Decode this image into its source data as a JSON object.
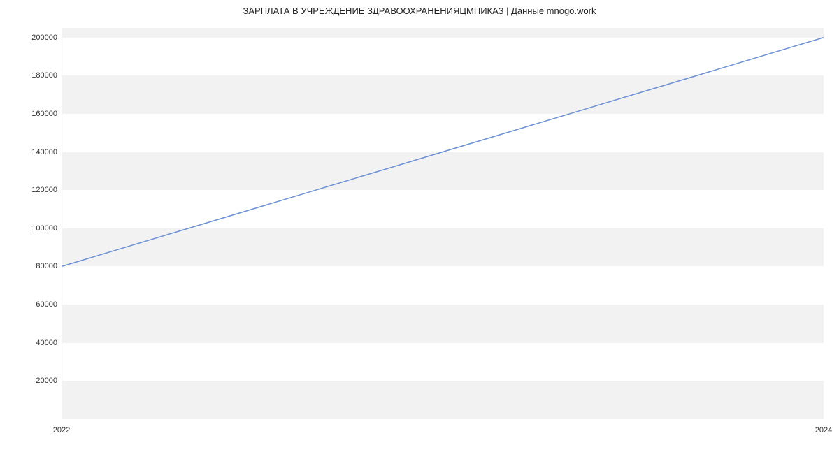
{
  "chart_data": {
    "type": "line",
    "title": "ЗАРПЛАТА В УЧРЕЖДЕНИЕ ЗДРАВООХРАНЕНИЯЦМПИКАЗ | Данные mnogo.work",
    "xlabel": "",
    "ylabel": "",
    "x": [
      2022,
      2024
    ],
    "values": [
      80000,
      200000
    ],
    "x_ticks": [
      "2022",
      "2024"
    ],
    "y_ticks": [
      "20000",
      "40000",
      "60000",
      "80000",
      "100000",
      "120000",
      "140000",
      "160000",
      "180000",
      "200000"
    ],
    "ylim": [
      0,
      205000
    ],
    "xlim": [
      2022,
      2024
    ],
    "line_color": "#6a8fd4"
  }
}
